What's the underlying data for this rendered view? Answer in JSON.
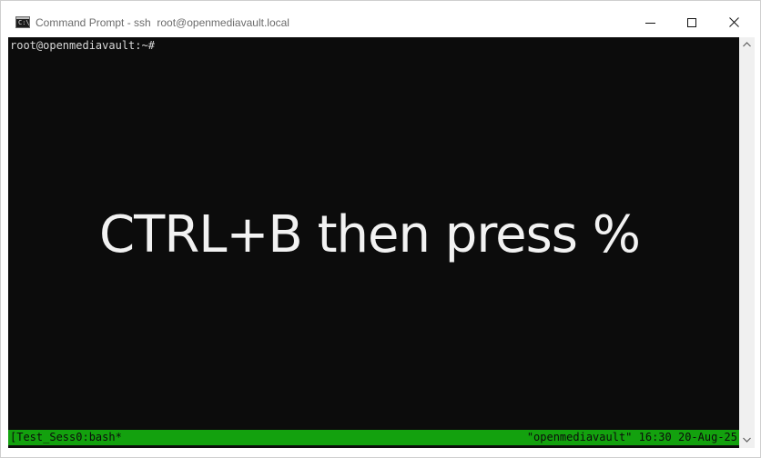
{
  "window": {
    "title": "Command Prompt - ssh  root@openmediavault.local",
    "icon": "command-prompt-icon",
    "icon_glyph": "C:\\",
    "controls": [
      "minimize-icon",
      "maximize-icon",
      "close-icon"
    ]
  },
  "terminal": {
    "prompt": "root@openmediavault:~#",
    "overlay_text": "CTRL+B then press %",
    "status_left": "[Test_Sess0:bash*",
    "status_right": "\"openmediavault\" 16:30 20-Aug-25"
  },
  "colors": {
    "terminal_bg": "#0c0c0c",
    "status_bar": "#13a10e",
    "text": "#d9d9d9"
  }
}
